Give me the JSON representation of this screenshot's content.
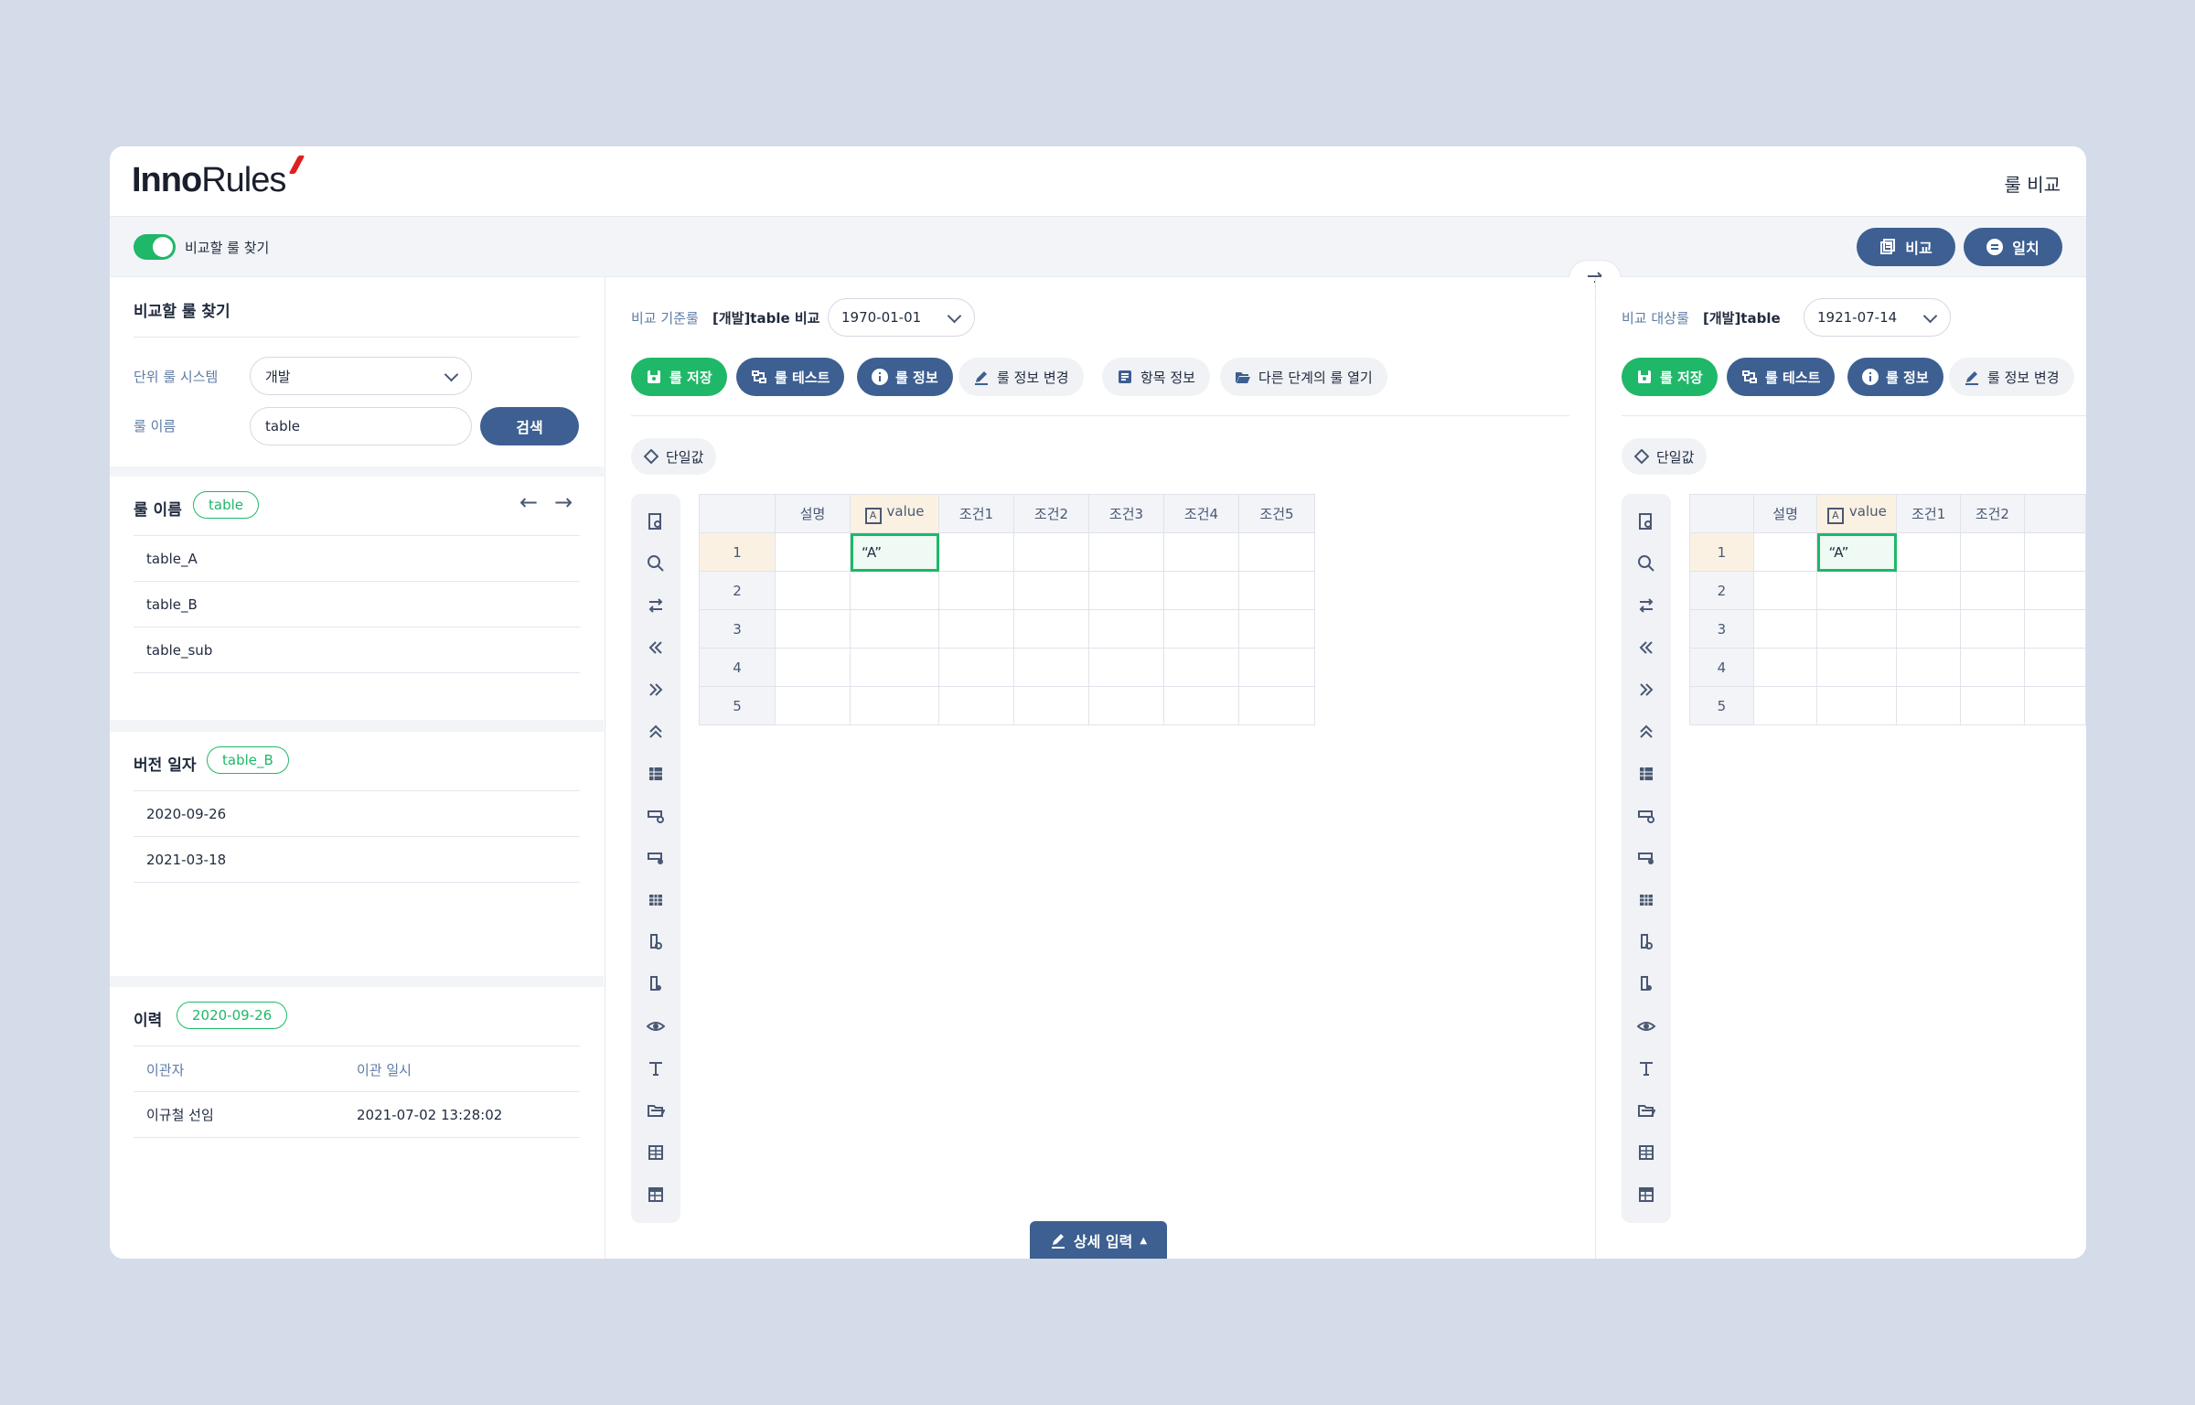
{
  "header": {
    "logo_bold": "Inno",
    "logo_light": "Rules",
    "title": "룰 비교"
  },
  "subbar": {
    "toggle_label": "비교할 룰 찾기",
    "compare_btn": "비교",
    "match_btn": "일치"
  },
  "left": {
    "search_title": "비교할 룰 찾기",
    "unit_system_label": "단위 룰 시스템",
    "unit_system_value": "개발",
    "rule_name_label": "룰 이름",
    "rule_name_value": "table",
    "search_btn": "검색",
    "rules_section": {
      "title": "룰 이름",
      "tag": "table",
      "items": [
        "table_A",
        "table_B",
        "table_sub"
      ]
    },
    "version_section": {
      "title": "버전 일자",
      "tag": "table_B",
      "items": [
        "2020-09-26",
        "2021-03-18"
      ]
    },
    "history_section": {
      "title": "이력",
      "tag": "2020-09-26",
      "col1": "이관자",
      "col2": "이관 일시",
      "rows": [
        {
          "user": "이규철 선임",
          "date": "2021-07-02 13:28:02"
        }
      ]
    }
  },
  "base": {
    "label": "비교 기준룰",
    "name": "[개발]table 비교",
    "date": "1970-01-01",
    "toolbar": {
      "save": "룰 저장",
      "test": "룰 테스트",
      "info": "룰 정보",
      "edit": "룰 정보 변경",
      "item": "항목 정보",
      "open": "다른 단계의 룰 열기"
    },
    "single_value": "단일값",
    "headers": [
      "설명",
      "value",
      "조건1",
      "조건2",
      "조건3",
      "조건4",
      "조건5"
    ],
    "rows": [
      "1",
      "2",
      "3",
      "4",
      "5"
    ],
    "cell_value": "“A”"
  },
  "target": {
    "label": "비교 대상룰",
    "name": "[개발]table",
    "date": "1921-07-14",
    "toolbar": {
      "save": "룰 저장",
      "test": "룰 테스트",
      "info": "룰 정보",
      "edit": "룰 정보 변경"
    },
    "single_value": "단일값",
    "headers": [
      "설명",
      "value",
      "조건1",
      "조건2"
    ],
    "rows": [
      "1",
      "2",
      "3",
      "4",
      "5"
    ],
    "cell_value": "“A”"
  },
  "detail_btn": "상세 입력",
  "colors": {
    "accent_green": "#1eb868",
    "primary_blue": "#3d5f91",
    "bg": "#d4dbe9"
  },
  "icons": [
    "file-search-icon",
    "search-icon",
    "swap-icon",
    "double-left-icon",
    "double-right-icon",
    "double-up-icon",
    "grid-icon",
    "row-add-icon",
    "row-remove-icon",
    "table-icon",
    "col-add-icon",
    "col-remove-icon",
    "eye-icon",
    "text-icon",
    "folder-icon",
    "table-grid-icon",
    "table-list-icon"
  ]
}
